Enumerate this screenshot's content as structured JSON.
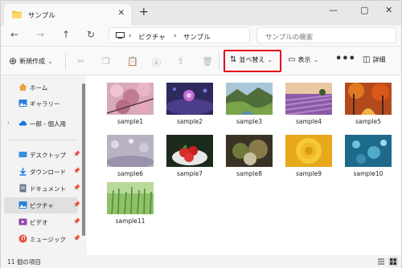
{
  "tab": {
    "title": "サンプル",
    "close": "✕",
    "new_tab": "+"
  },
  "window_controls": {
    "minimize": "—",
    "maximize": "▢",
    "close": "✕"
  },
  "nav": {
    "back": "←",
    "forward": "→",
    "up": "↑",
    "refresh": "↻"
  },
  "address": {
    "separator": "›",
    "segments": [
      "ピクチャ",
      "サンプル"
    ]
  },
  "search": {
    "placeholder": "サンプルの検索"
  },
  "toolbar": {
    "new_label": "新規作成",
    "sort_label": "並べ替え",
    "view_label": "表示",
    "details_label": "詳細",
    "more": "•••",
    "dropdown": "⌄"
  },
  "sidebar": {
    "items": [
      {
        "label": "ホーム",
        "icon": "home-icon"
      },
      {
        "label": "ギャラリー",
        "icon": "gallery-icon"
      },
      {
        "label": "一郎 - 個人用",
        "icon": "cloud-icon"
      },
      {
        "label": "デスクトップ",
        "icon": "desktop-icon"
      },
      {
        "label": "ダウンロード",
        "icon": "download-icon"
      },
      {
        "label": "ドキュメント",
        "icon": "documents-icon"
      },
      {
        "label": "ピクチャ",
        "icon": "pictures-icon"
      },
      {
        "label": "ビデオ",
        "icon": "video-icon"
      },
      {
        "label": "ミュージック",
        "icon": "music-icon"
      }
    ]
  },
  "files": [
    {
      "name": "sample1"
    },
    {
      "name": "sample2"
    },
    {
      "name": "sample3"
    },
    {
      "name": "sample4"
    },
    {
      "name": "sample5"
    },
    {
      "name": "sample6"
    },
    {
      "name": "sample7"
    },
    {
      "name": "sample8"
    },
    {
      "name": "sample9"
    },
    {
      "name": "sample10"
    },
    {
      "name": "sample11"
    }
  ],
  "status": {
    "item_count": "11 個の項目"
  },
  "colors": {
    "highlight": "#e60012",
    "folder": "#f4c542",
    "accent": "#0067c0"
  }
}
